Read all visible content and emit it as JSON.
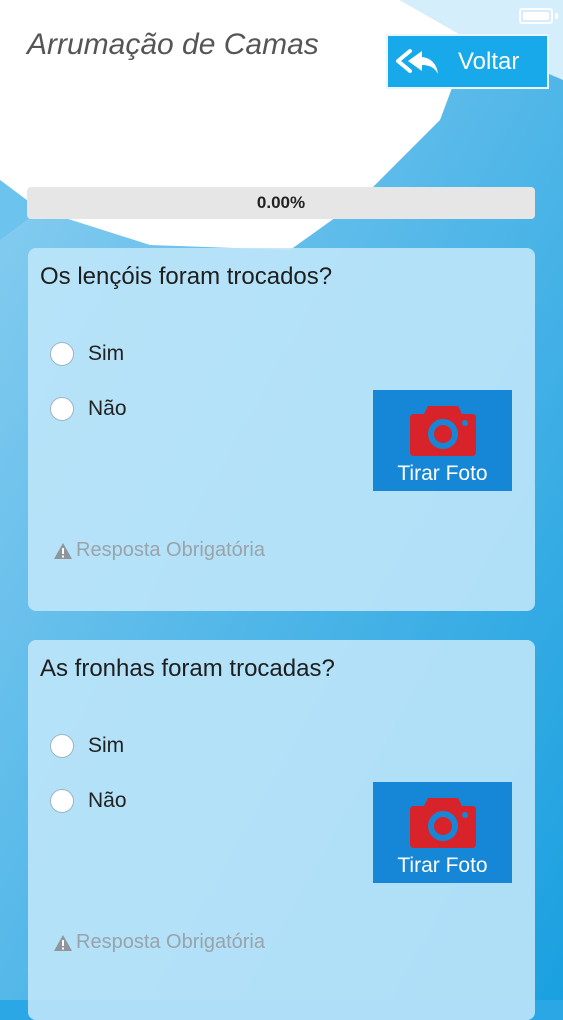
{
  "header": {
    "title": "Arrumação de Camas",
    "back_label": "Voltar"
  },
  "progress": {
    "text": "0.00%",
    "value": 0
  },
  "questions": [
    {
      "text": "Os lençóis foram trocados?",
      "options": [
        "Sim",
        "Não"
      ],
      "photo_label": "Tirar Foto",
      "required_label": "Resposta Obrigatória"
    },
    {
      "text": "As fronhas foram trocadas?",
      "options": [
        "Sim",
        "Não"
      ],
      "photo_label": "Tirar Foto",
      "required_label": "Resposta Obrigatória"
    }
  ],
  "colors": {
    "accent": "#17a9ea",
    "photo_button": "#1687d6",
    "camera_icon": "#d9232a",
    "card": "#bee5fa"
  }
}
